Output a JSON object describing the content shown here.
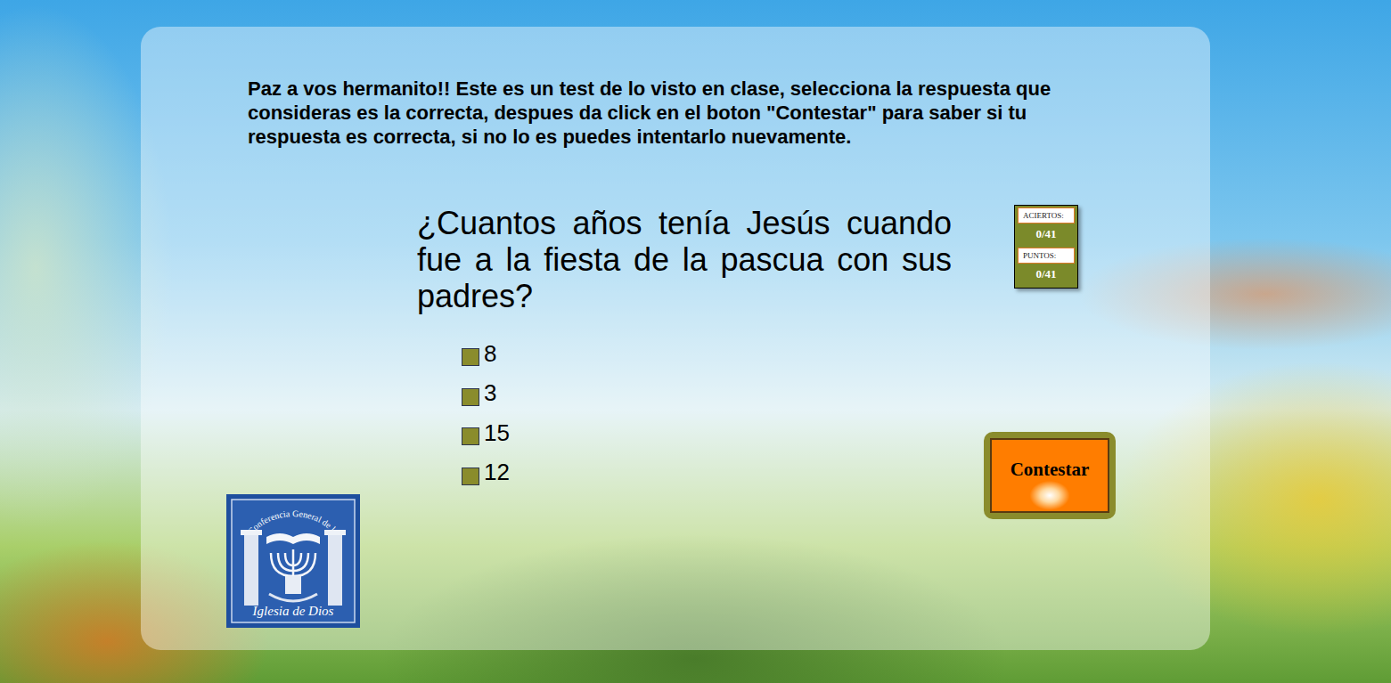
{
  "instructions": "Paz a vos hermanito!! Este es un test de lo visto en clase, selecciona la respuesta que consideras es la correcta, despues da click en el boton \"Contestar\" para saber si tu respuesta es correcta, si no lo es puedes intentarlo nuevamente.",
  "question": "¿Cuantos años tenía Jesús cuando fue a la fiesta de la pascua con sus padres?",
  "options": [
    {
      "label": "8",
      "selected": false
    },
    {
      "label": "3",
      "selected": false
    },
    {
      "label": "15",
      "selected": false
    },
    {
      "label": "12",
      "selected": false
    }
  ],
  "score": [
    {
      "label": "ACIERTOS:",
      "value": "0/41"
    },
    {
      "label": "PUNTOS:",
      "value": "0/41"
    }
  ],
  "submit_button": "Contestar",
  "logo": {
    "top_text": "Conferencia General de la",
    "bottom_text": "Iglesia de Dios"
  }
}
